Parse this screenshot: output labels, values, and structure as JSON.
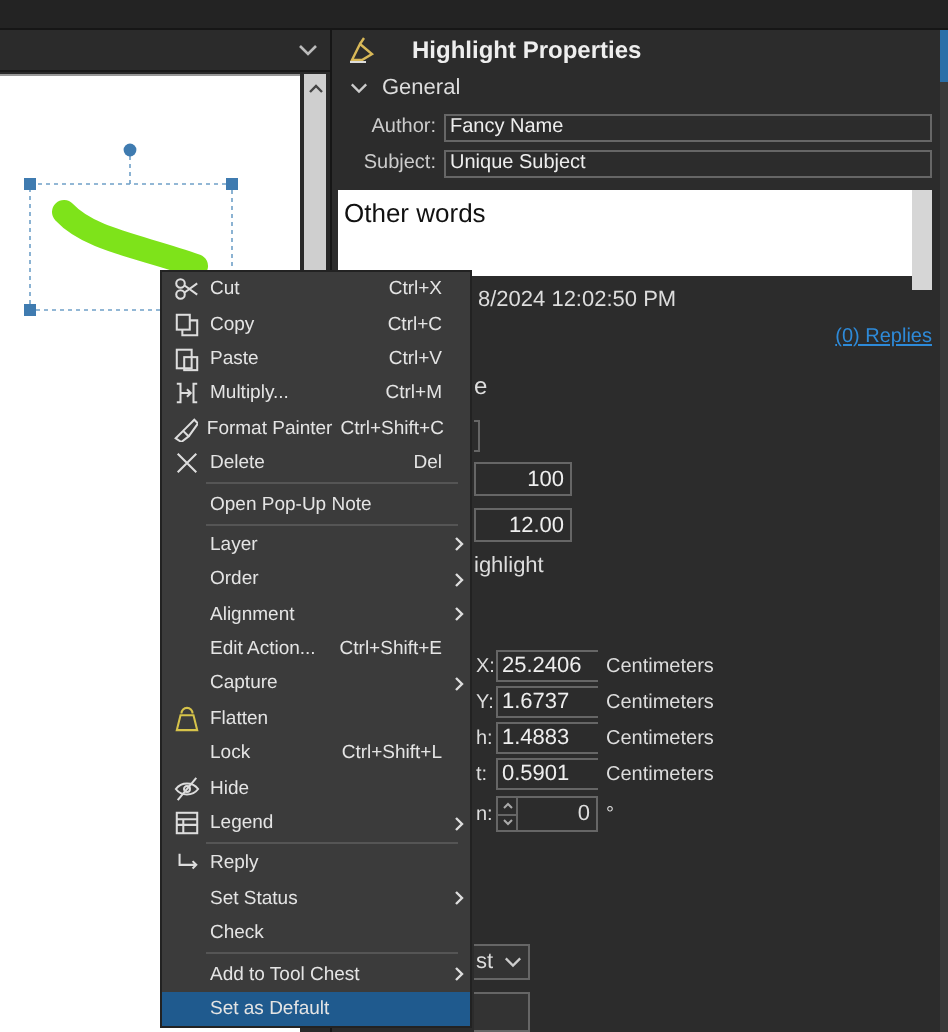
{
  "properties": {
    "title": "Highlight Properties",
    "section": {
      "label": "General",
      "expanded": true
    },
    "author": {
      "label": "Author:",
      "value": "Fancy Name"
    },
    "subject": {
      "label": "Subject:",
      "value": "Unique Subject"
    },
    "comments": "Other words",
    "date_fragment": "8/2024 12:02:50 PM",
    "replies_link": "(0) Replies",
    "label_fragment": "e",
    "fields": [
      {
        "value": "100"
      },
      {
        "value": "12.00"
      }
    ],
    "option_fragment": "ighlight",
    "position_rows": [
      {
        "label": "X:",
        "value": "25.2406",
        "unit": "Centimeters"
      },
      {
        "label": "Y:",
        "value": "1.6737",
        "unit": "Centimeters"
      },
      {
        "label": "h:",
        "value": "1.4883",
        "unit": "Centimeters"
      },
      {
        "label": "t:",
        "value": "0.5901",
        "unit": "Centimeters"
      }
    ],
    "rotation": {
      "label": "n:",
      "value": "0",
      "unit": "°"
    },
    "dropdown": {
      "value": "st"
    }
  },
  "context_menu": [
    {
      "kind": "item",
      "label": "Cut",
      "shortcut": "Ctrl+X",
      "submenu": false,
      "selected": false
    },
    {
      "kind": "item",
      "label": "Copy",
      "shortcut": "Ctrl+C",
      "submenu": false,
      "selected": false
    },
    {
      "kind": "item",
      "label": "Paste",
      "shortcut": "Ctrl+V",
      "submenu": false,
      "selected": false
    },
    {
      "kind": "item",
      "label": "Multiply...",
      "shortcut": "Ctrl+M",
      "submenu": false,
      "selected": false
    },
    {
      "kind": "item",
      "label": "Format Painter",
      "shortcut": "Ctrl+Shift+C",
      "submenu": false,
      "selected": false
    },
    {
      "kind": "item",
      "label": "Delete",
      "shortcut": "Del",
      "submenu": false,
      "selected": false
    },
    {
      "kind": "separator"
    },
    {
      "kind": "item",
      "label": "Open Pop-Up Note",
      "submenu": false,
      "selected": false
    },
    {
      "kind": "separator"
    },
    {
      "kind": "item",
      "label": "Layer",
      "submenu": true,
      "selected": false
    },
    {
      "kind": "item",
      "label": "Order",
      "submenu": true,
      "selected": false
    },
    {
      "kind": "item",
      "label": "Alignment",
      "submenu": true,
      "selected": false
    },
    {
      "kind": "item",
      "label": "Edit Action...",
      "shortcut": "Ctrl+Shift+E",
      "submenu": false,
      "selected": false
    },
    {
      "kind": "item",
      "label": "Capture",
      "submenu": true,
      "selected": false
    },
    {
      "kind": "item",
      "label": "Flatten",
      "submenu": false,
      "selected": false
    },
    {
      "kind": "item",
      "label": "Lock",
      "shortcut": "Ctrl+Shift+L",
      "submenu": false,
      "selected": false
    },
    {
      "kind": "item",
      "label": "Hide",
      "submenu": false,
      "selected": false
    },
    {
      "kind": "item",
      "label": "Legend",
      "submenu": true,
      "selected": false
    },
    {
      "kind": "separator"
    },
    {
      "kind": "item",
      "label": "Reply",
      "submenu": false,
      "selected": false
    },
    {
      "kind": "item",
      "label": "Set Status",
      "submenu": true,
      "selected": false
    },
    {
      "kind": "item",
      "label": "Check",
      "submenu": false,
      "selected": false
    },
    {
      "kind": "separator"
    },
    {
      "kind": "item",
      "label": "Add to Tool Chest",
      "submenu": true,
      "selected": false
    },
    {
      "kind": "item",
      "label": "Set as Default",
      "submenu": false,
      "selected": true
    }
  ]
}
